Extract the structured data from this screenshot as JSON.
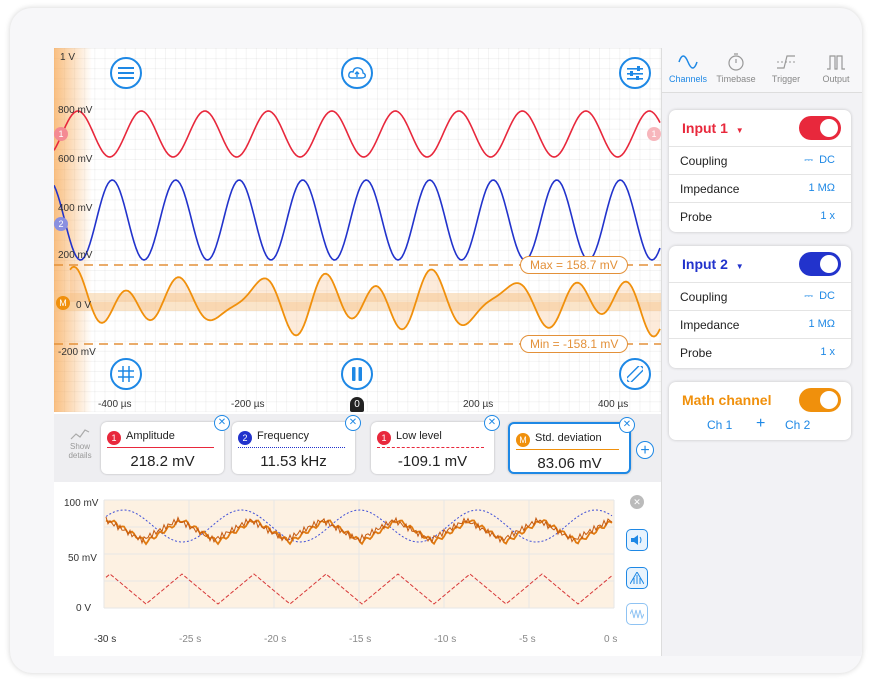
{
  "scope": {
    "y_labels": [
      "1 V",
      "800 mV",
      "600 mV",
      "400 mV",
      "200 mV",
      "0 V",
      "-200 mV"
    ],
    "x_labels": [
      "-400 µs",
      "-200 µs",
      "0",
      "200 µs",
      "400 µs"
    ],
    "max_marker": "Max = 158.7 mV",
    "min_marker": "Min = -158.1 mV",
    "channel_markers": {
      "ch1": "1",
      "ch2": "2",
      "math": "M"
    },
    "colors": {
      "ch1": "#e8283c",
      "ch2": "#2233cc",
      "math": "#f0900c",
      "accent": "#1e88e5"
    },
    "icons": {
      "menu": "menu-icon",
      "cloud": "cloud-upload-icon",
      "settings": "sliders-icon",
      "grid": "grid-icon",
      "pause": "pause-icon",
      "ruler": "ruler-icon"
    }
  },
  "measurements": {
    "show_details": "Show details",
    "cards": [
      {
        "badge": "1",
        "name": "Amplitude",
        "value": "218.2 mV",
        "color": "#e8283c"
      },
      {
        "badge": "2",
        "name": "Frequency",
        "value": "11.53 kHz",
        "color": "#2233cc"
      },
      {
        "badge": "1",
        "name": "Low level",
        "value": "-109.1 mV",
        "color": "#e8283c"
      },
      {
        "badge": "M",
        "name": "Std. deviation",
        "value": "83.06 mV",
        "color": "#f0900c"
      }
    ]
  },
  "roll": {
    "y_labels": [
      "100 mV",
      "50 mV",
      "0 V"
    ],
    "x_labels": [
      "-30 s",
      "-25 s",
      "-20 s",
      "-15 s",
      "-10 s",
      "-5 s",
      "0 s"
    ]
  },
  "sidebar": {
    "tabs": [
      "Channels",
      "Timebase",
      "Trigger",
      "Output"
    ],
    "active_tab": "Channels",
    "input1": {
      "title": "Input 1",
      "rows": [
        [
          "Coupling",
          "DC"
        ],
        [
          "Impedance",
          "1 MΩ"
        ],
        [
          "Probe",
          "1 x"
        ]
      ]
    },
    "input2": {
      "title": "Input 2",
      "rows": [
        [
          "Coupling",
          "DC"
        ],
        [
          "Impedance",
          "1 MΩ"
        ],
        [
          "Probe",
          "1 x"
        ]
      ]
    },
    "math": {
      "title": "Math channel",
      "left": "Ch 1",
      "op": "+",
      "right": "Ch 2"
    }
  }
}
